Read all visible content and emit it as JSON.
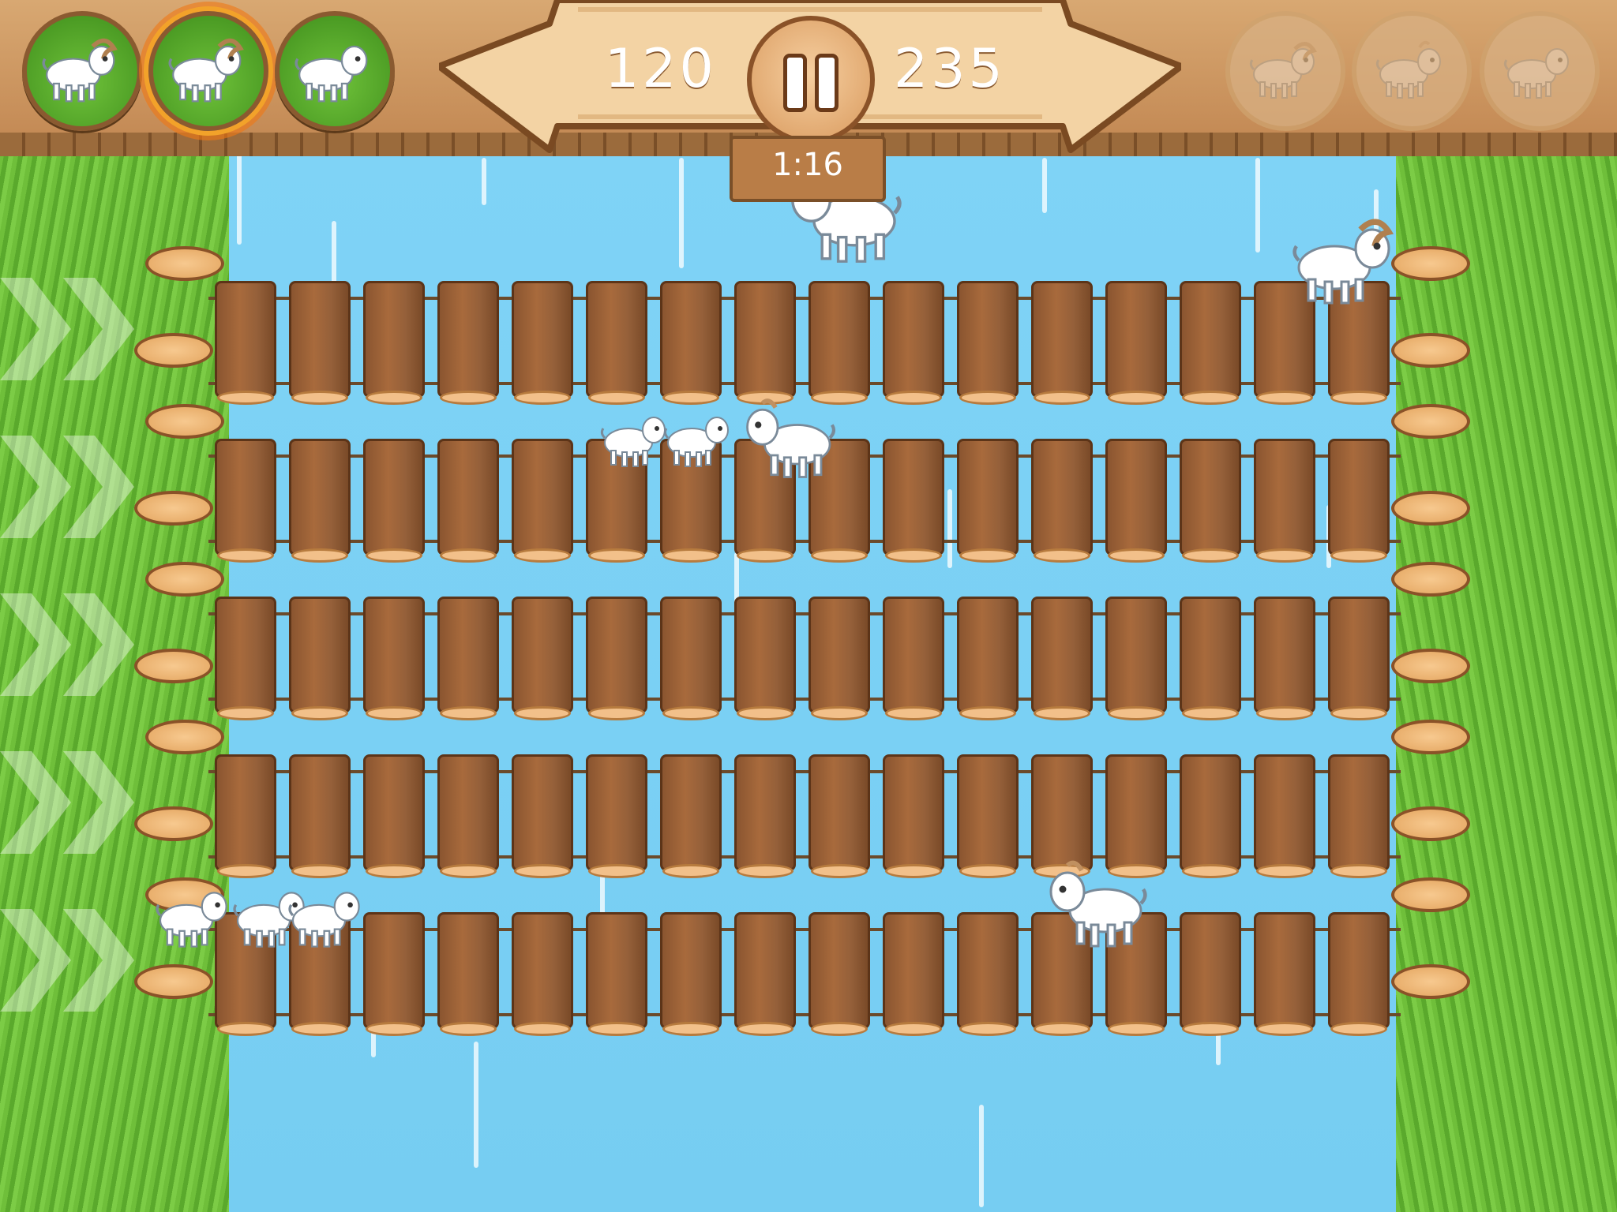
{
  "hud": {
    "score_left": "120",
    "score_right": "235",
    "timer": "1:16",
    "left_goat_slots": [
      {
        "name": "big-horned-goat",
        "state": "ready"
      },
      {
        "name": "big-horned-goat",
        "state": "selected"
      },
      {
        "name": "baby-goat",
        "state": "ready"
      }
    ],
    "right_goat_slots": [
      {
        "name": "big-horned-goat",
        "state": "inactive"
      },
      {
        "name": "medium-goat",
        "state": "inactive"
      },
      {
        "name": "baby-goat",
        "state": "inactive"
      }
    ]
  },
  "lanes": 5,
  "icons": {
    "pause": "pause-icon",
    "lane_arrow": "chevron-right-icon"
  },
  "colors": {
    "water": "#7fd3f6",
    "grass": "#6fbf3a",
    "wood": "#a86a3c",
    "hud_wood": "#d8a872",
    "active_slot": "#4f9f24",
    "selected_glow": "#f2a22a"
  }
}
